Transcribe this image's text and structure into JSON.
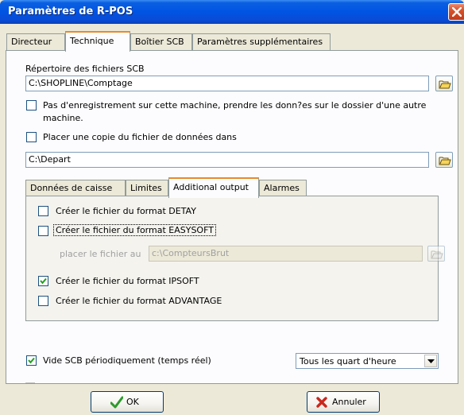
{
  "window": {
    "title": "Paramètres de R-POS"
  },
  "tabs": [
    {
      "label": "Directeur",
      "active": false
    },
    {
      "label": "Technique",
      "active": true
    },
    {
      "label": "Boîtier SCB",
      "active": false
    },
    {
      "label": "Paramètres supplémentaires",
      "active": false
    }
  ],
  "technique": {
    "scb_dir_label": "Répertoire des fichiers SCB",
    "scb_dir_value": "C:\\SHOPLINE\\Comptage",
    "no_record_label_line1": "Pas d'enregistrement sur cette machine, prendre les donn?es sur le dossier d'une autre",
    "no_record_label_line2": "machine.",
    "no_record_checked": false,
    "copy_label": "Placer une copie du fichier de données dans",
    "copy_checked": false,
    "copy_dir_value": "C:\\Depart"
  },
  "inner_tabs": [
    {
      "label": "Données de caisse",
      "active": false
    },
    {
      "label": "Limites",
      "active": false
    },
    {
      "label": "Additional output",
      "active": true
    },
    {
      "label": "Alarmes",
      "active": false
    }
  ],
  "additional_output": {
    "detay_label": "Créer le fichier du format DETAY",
    "detay_checked": false,
    "easysoft_label": "Créer le fichier du format EASYSOFT",
    "easysoft_checked": false,
    "place_file_label": "placer le fichier au",
    "place_file_value": "c:\\CompteursBrut",
    "ipsoft_label": "Créer le fichier du format IPSOFT",
    "ipsoft_checked": true,
    "advantage_label": "Créer le fichier du format ADVANTAGE",
    "advantage_checked": false
  },
  "periodic": {
    "label": "Vide SCB périodiquement (temps réel)",
    "checked": true,
    "interval_value": "Tous les quart d'heure"
  },
  "buttons": {
    "ok_label": "OK",
    "cancel_label": "Annuler"
  },
  "colors": {
    "titlebar": "#0054e3",
    "tab_highlight": "#e68b2c",
    "ok_check": "#2d9b2d",
    "cancel_x": "#c8281e"
  }
}
